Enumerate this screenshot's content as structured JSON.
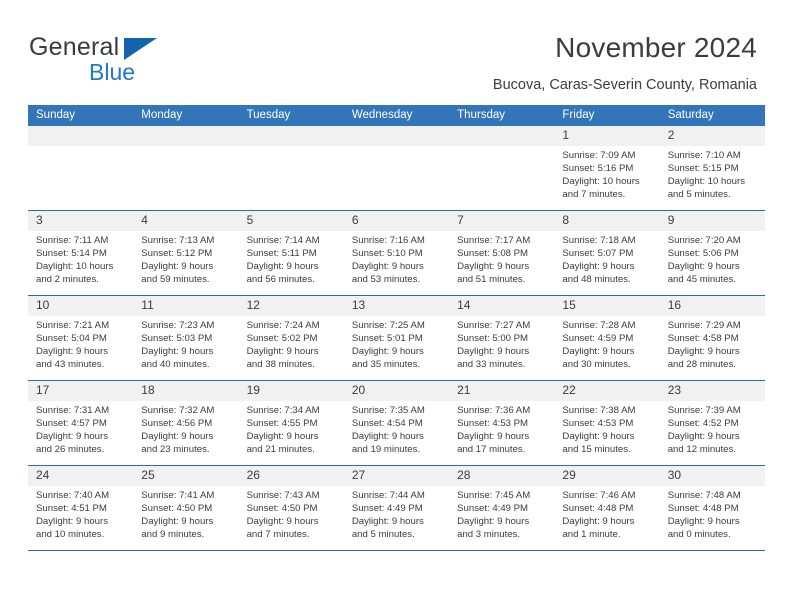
{
  "brand": {
    "name_top": "General",
    "name_bottom": "Blue",
    "logo_icon": "triangle-icon",
    "accent_color": "#1265ac",
    "blue_text_color": "#2277c8"
  },
  "header": {
    "title": "November 2024",
    "subtitle": "Bucova, Caras-Severin County, Romania"
  },
  "theme": {
    "header_row_bg": "#3275b9",
    "daynum_bg": "#f1f1f1",
    "grid_line": "#2e6da4",
    "text": "#3c3c3c"
  },
  "calendar": {
    "weekday_headers": [
      "Sunday",
      "Monday",
      "Tuesday",
      "Wednesday",
      "Thursday",
      "Friday",
      "Saturday"
    ],
    "weeks": [
      [
        {
          "day": "",
          "empty": true,
          "sunrise": "",
          "sunset": "",
          "daylight1": "",
          "daylight2": ""
        },
        {
          "day": "",
          "empty": true,
          "sunrise": "",
          "sunset": "",
          "daylight1": "",
          "daylight2": ""
        },
        {
          "day": "",
          "empty": true,
          "sunrise": "",
          "sunset": "",
          "daylight1": "",
          "daylight2": ""
        },
        {
          "day": "",
          "empty": true,
          "sunrise": "",
          "sunset": "",
          "daylight1": "",
          "daylight2": ""
        },
        {
          "day": "",
          "empty": true,
          "sunrise": "",
          "sunset": "",
          "daylight1": "",
          "daylight2": ""
        },
        {
          "day": "1",
          "sunrise": "Sunrise: 7:09 AM",
          "sunset": "Sunset: 5:16 PM",
          "daylight1": "Daylight: 10 hours",
          "daylight2": "and 7 minutes."
        },
        {
          "day": "2",
          "sunrise": "Sunrise: 7:10 AM",
          "sunset": "Sunset: 5:15 PM",
          "daylight1": "Daylight: 10 hours",
          "daylight2": "and 5 minutes."
        }
      ],
      [
        {
          "day": "3",
          "sunrise": "Sunrise: 7:11 AM",
          "sunset": "Sunset: 5:14 PM",
          "daylight1": "Daylight: 10 hours",
          "daylight2": "and 2 minutes."
        },
        {
          "day": "4",
          "sunrise": "Sunrise: 7:13 AM",
          "sunset": "Sunset: 5:12 PM",
          "daylight1": "Daylight: 9 hours",
          "daylight2": "and 59 minutes."
        },
        {
          "day": "5",
          "sunrise": "Sunrise: 7:14 AM",
          "sunset": "Sunset: 5:11 PM",
          "daylight1": "Daylight: 9 hours",
          "daylight2": "and 56 minutes."
        },
        {
          "day": "6",
          "sunrise": "Sunrise: 7:16 AM",
          "sunset": "Sunset: 5:10 PM",
          "daylight1": "Daylight: 9 hours",
          "daylight2": "and 53 minutes."
        },
        {
          "day": "7",
          "sunrise": "Sunrise: 7:17 AM",
          "sunset": "Sunset: 5:08 PM",
          "daylight1": "Daylight: 9 hours",
          "daylight2": "and 51 minutes."
        },
        {
          "day": "8",
          "sunrise": "Sunrise: 7:18 AM",
          "sunset": "Sunset: 5:07 PM",
          "daylight1": "Daylight: 9 hours",
          "daylight2": "and 48 minutes."
        },
        {
          "day": "9",
          "sunrise": "Sunrise: 7:20 AM",
          "sunset": "Sunset: 5:06 PM",
          "daylight1": "Daylight: 9 hours",
          "daylight2": "and 45 minutes."
        }
      ],
      [
        {
          "day": "10",
          "sunrise": "Sunrise: 7:21 AM",
          "sunset": "Sunset: 5:04 PM",
          "daylight1": "Daylight: 9 hours",
          "daylight2": "and 43 minutes."
        },
        {
          "day": "11",
          "sunrise": "Sunrise: 7:23 AM",
          "sunset": "Sunset: 5:03 PM",
          "daylight1": "Daylight: 9 hours",
          "daylight2": "and 40 minutes."
        },
        {
          "day": "12",
          "sunrise": "Sunrise: 7:24 AM",
          "sunset": "Sunset: 5:02 PM",
          "daylight1": "Daylight: 9 hours",
          "daylight2": "and 38 minutes."
        },
        {
          "day": "13",
          "sunrise": "Sunrise: 7:25 AM",
          "sunset": "Sunset: 5:01 PM",
          "daylight1": "Daylight: 9 hours",
          "daylight2": "and 35 minutes."
        },
        {
          "day": "14",
          "sunrise": "Sunrise: 7:27 AM",
          "sunset": "Sunset: 5:00 PM",
          "daylight1": "Daylight: 9 hours",
          "daylight2": "and 33 minutes."
        },
        {
          "day": "15",
          "sunrise": "Sunrise: 7:28 AM",
          "sunset": "Sunset: 4:59 PM",
          "daylight1": "Daylight: 9 hours",
          "daylight2": "and 30 minutes."
        },
        {
          "day": "16",
          "sunrise": "Sunrise: 7:29 AM",
          "sunset": "Sunset: 4:58 PM",
          "daylight1": "Daylight: 9 hours",
          "daylight2": "and 28 minutes."
        }
      ],
      [
        {
          "day": "17",
          "sunrise": "Sunrise: 7:31 AM",
          "sunset": "Sunset: 4:57 PM",
          "daylight1": "Daylight: 9 hours",
          "daylight2": "and 26 minutes."
        },
        {
          "day": "18",
          "sunrise": "Sunrise: 7:32 AM",
          "sunset": "Sunset: 4:56 PM",
          "daylight1": "Daylight: 9 hours",
          "daylight2": "and 23 minutes."
        },
        {
          "day": "19",
          "sunrise": "Sunrise: 7:34 AM",
          "sunset": "Sunset: 4:55 PM",
          "daylight1": "Daylight: 9 hours",
          "daylight2": "and 21 minutes."
        },
        {
          "day": "20",
          "sunrise": "Sunrise: 7:35 AM",
          "sunset": "Sunset: 4:54 PM",
          "daylight1": "Daylight: 9 hours",
          "daylight2": "and 19 minutes."
        },
        {
          "day": "21",
          "sunrise": "Sunrise: 7:36 AM",
          "sunset": "Sunset: 4:53 PM",
          "daylight1": "Daylight: 9 hours",
          "daylight2": "and 17 minutes."
        },
        {
          "day": "22",
          "sunrise": "Sunrise: 7:38 AM",
          "sunset": "Sunset: 4:53 PM",
          "daylight1": "Daylight: 9 hours",
          "daylight2": "and 15 minutes."
        },
        {
          "day": "23",
          "sunrise": "Sunrise: 7:39 AM",
          "sunset": "Sunset: 4:52 PM",
          "daylight1": "Daylight: 9 hours",
          "daylight2": "and 12 minutes."
        }
      ],
      [
        {
          "day": "24",
          "sunrise": "Sunrise: 7:40 AM",
          "sunset": "Sunset: 4:51 PM",
          "daylight1": "Daylight: 9 hours",
          "daylight2": "and 10 minutes."
        },
        {
          "day": "25",
          "sunrise": "Sunrise: 7:41 AM",
          "sunset": "Sunset: 4:50 PM",
          "daylight1": "Daylight: 9 hours",
          "daylight2": "and 9 minutes."
        },
        {
          "day": "26",
          "sunrise": "Sunrise: 7:43 AM",
          "sunset": "Sunset: 4:50 PM",
          "daylight1": "Daylight: 9 hours",
          "daylight2": "and 7 minutes."
        },
        {
          "day": "27",
          "sunrise": "Sunrise: 7:44 AM",
          "sunset": "Sunset: 4:49 PM",
          "daylight1": "Daylight: 9 hours",
          "daylight2": "and 5 minutes."
        },
        {
          "day": "28",
          "sunrise": "Sunrise: 7:45 AM",
          "sunset": "Sunset: 4:49 PM",
          "daylight1": "Daylight: 9 hours",
          "daylight2": "and 3 minutes."
        },
        {
          "day": "29",
          "sunrise": "Sunrise: 7:46 AM",
          "sunset": "Sunset: 4:48 PM",
          "daylight1": "Daylight: 9 hours",
          "daylight2": "and 1 minute."
        },
        {
          "day": "30",
          "sunrise": "Sunrise: 7:48 AM",
          "sunset": "Sunset: 4:48 PM",
          "daylight1": "Daylight: 9 hours",
          "daylight2": "and 0 minutes."
        }
      ]
    ]
  }
}
